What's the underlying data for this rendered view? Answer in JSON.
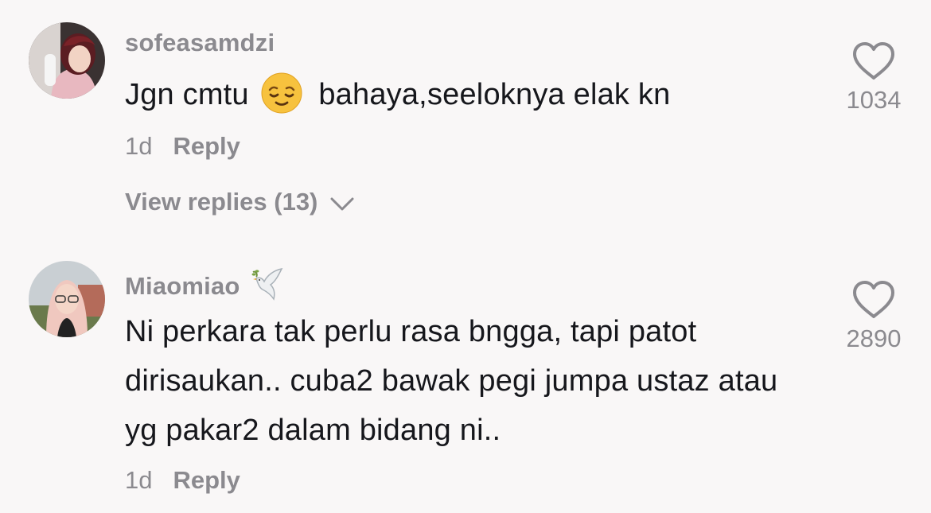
{
  "comments": [
    {
      "username": "sofeasamdzi",
      "text_before": "Jgn cmtu",
      "emoji": "relieved-face-emoji",
      "text_after": "bahaya,seeloknya elak kn",
      "time": "1d",
      "reply_label": "Reply",
      "view_replies_label": "View replies (13)",
      "likes": "1034"
    },
    {
      "username": "Miaomiao",
      "username_emoji": "dove-emoji",
      "text": "Ni perkara tak perlu rasa bngga, tapi patot dirisaukan.. cuba2 bawak pegi jumpa ustaz atau yg pakar2 dalam bidang ni..",
      "time": "1d",
      "reply_label": "Reply",
      "likes": "2890"
    }
  ],
  "colors": {
    "background": "#f9f7f7",
    "text_primary": "#16171c",
    "text_secondary": "#8b8a8f"
  }
}
